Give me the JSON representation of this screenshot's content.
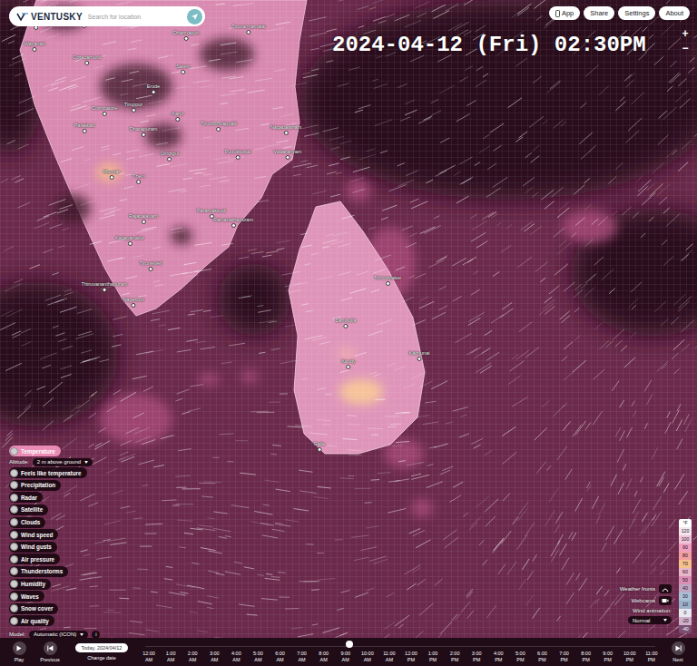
{
  "header": {
    "logo": "VENTUSKY",
    "search_placeholder": "Search for location"
  },
  "top_buttons": [
    {
      "label": "App"
    },
    {
      "label": "Share"
    },
    {
      "label": "Settings"
    },
    {
      "label": "About"
    }
  ],
  "timestamp": "2024-04-12 (Fri) 02:30PM",
  "zoom": [
    "+",
    "−"
  ],
  "places": [
    {
      "name": "Hunsur"
    },
    {
      "name": "Mysuru"
    },
    {
      "name": "Dharmapuri"
    },
    {
      "name": "Tiruvannamalai"
    },
    {
      "name": "Wayanad"
    },
    {
      "name": "Ootacamund"
    },
    {
      "name": "Salem"
    },
    {
      "name": "Erode"
    },
    {
      "name": "Coimbatore"
    },
    {
      "name": "Tiruppur"
    },
    {
      "name": "Karur"
    },
    {
      "name": "Palakkad"
    },
    {
      "name": "Dharapuram"
    },
    {
      "name": "Tiruchchirappalli"
    },
    {
      "name": "Nagapattinam"
    },
    {
      "name": "Pudukkottai"
    },
    {
      "name": "Vedaranyam"
    },
    {
      "name": "Dindigul"
    },
    {
      "name": "Munnar"
    },
    {
      "name": "Theni"
    },
    {
      "name": "Rajapalayam"
    },
    {
      "name": "Paramakkudi"
    },
    {
      "name": "Ramanathapuram"
    },
    {
      "name": "Kadayanallur"
    },
    {
      "name": "Tirunelveli"
    },
    {
      "name": "Thiruvananthapuram"
    },
    {
      "name": "Nagercoil"
    },
    {
      "name": "Trincomalee"
    },
    {
      "name": "Dambulla"
    },
    {
      "name": "Kandy"
    },
    {
      "name": "Kalmunai"
    },
    {
      "name": "Galle"
    }
  ],
  "layers": {
    "items": [
      {
        "label": "Temperature",
        "selected": true
      },
      {
        "label": "Feels like temperature",
        "selected": false
      },
      {
        "label": "Precipitation",
        "selected": false
      },
      {
        "label": "Radar",
        "selected": false
      },
      {
        "label": "Satellite",
        "selected": false
      },
      {
        "label": "Clouds",
        "selected": false
      },
      {
        "label": "Wind speed",
        "selected": false
      },
      {
        "label": "Wind gusts",
        "selected": false
      },
      {
        "label": "Air pressure",
        "selected": false
      },
      {
        "label": "Thunderstorms",
        "selected": false
      },
      {
        "label": "Humidity",
        "selected": false
      },
      {
        "label": "Waves",
        "selected": false
      },
      {
        "label": "Snow cover",
        "selected": false
      },
      {
        "label": "Air quality",
        "selected": false
      }
    ],
    "altitude_label": "Altitude:",
    "altitude_value": "2 m above ground",
    "model_label": "Model:",
    "model_value": "Automatic (ICON)",
    "info": "i"
  },
  "legend": {
    "unit": "°F",
    "ticks": [
      {
        "label": "120",
        "color": "#f3e6ee"
      },
      {
        "label": "100",
        "color": "#efc6d9"
      },
      {
        "label": "90",
        "color": "#ef9fc0"
      },
      {
        "label": "80",
        "color": "#f0a0a0"
      },
      {
        "label": "70",
        "color": "#f4c08c"
      },
      {
        "label": "60",
        "color": "#e7b6c8"
      },
      {
        "label": "50",
        "color": "#d98fb3"
      },
      {
        "label": "40",
        "color": "#bfa6c3"
      },
      {
        "label": "30",
        "color": "#a8c0d8"
      },
      {
        "label": "10",
        "color": "#9ab0c8"
      },
      {
        "label": "0",
        "color": "#e8e8f0"
      },
      {
        "label": "-20",
        "color": "#d0b0c8"
      },
      {
        "label": "-40",
        "color": "#7a4f72"
      }
    ]
  },
  "options": {
    "weather_fronts": "Weather fronts",
    "webcams": "Webcams",
    "wind_animation_label": "Wind animation:",
    "wind_animation_value": "Normal"
  },
  "timeline": {
    "play": "Play",
    "previous": "Previous",
    "date": "Today, 2024/04/12",
    "change_date": "Change date",
    "next": "Next",
    "level": 0.4,
    "hours": [
      {
        "time": "12:00",
        "ampm": "AM"
      },
      {
        "time": "1:00",
        "ampm": "AM"
      },
      {
        "time": "2:00",
        "ampm": "AM"
      },
      {
        "time": "3:00",
        "ampm": "AM"
      },
      {
        "time": "4:00",
        "ampm": "AM"
      },
      {
        "time": "5:00",
        "ampm": "AM"
      },
      {
        "time": "6:00",
        "ampm": "AM"
      },
      {
        "time": "7:00",
        "ampm": "AM"
      },
      {
        "time": "8:00",
        "ampm": "AM"
      },
      {
        "time": "9:00",
        "ampm": "AM"
      },
      {
        "time": "10:00",
        "ampm": "AM"
      },
      {
        "time": "11:00",
        "ampm": "AM"
      },
      {
        "time": "12:00",
        "ampm": "PM"
      },
      {
        "time": "1:00",
        "ampm": "PM"
      },
      {
        "time": "2:00",
        "ampm": "PM"
      },
      {
        "time": "3:00",
        "ampm": "PM"
      },
      {
        "time": "4:00",
        "ampm": "PM"
      },
      {
        "time": "5:00",
        "ampm": "PM"
      },
      {
        "time": "6:00",
        "ampm": "PM"
      },
      {
        "time": "7:00",
        "ampm": "PM"
      },
      {
        "time": "8:00",
        "ampm": "PM"
      },
      {
        "time": "9:00",
        "ampm": "PM"
      },
      {
        "time": "10:00",
        "ampm": "PM"
      },
      {
        "time": "11:00",
        "ampm": "PM"
      }
    ]
  }
}
